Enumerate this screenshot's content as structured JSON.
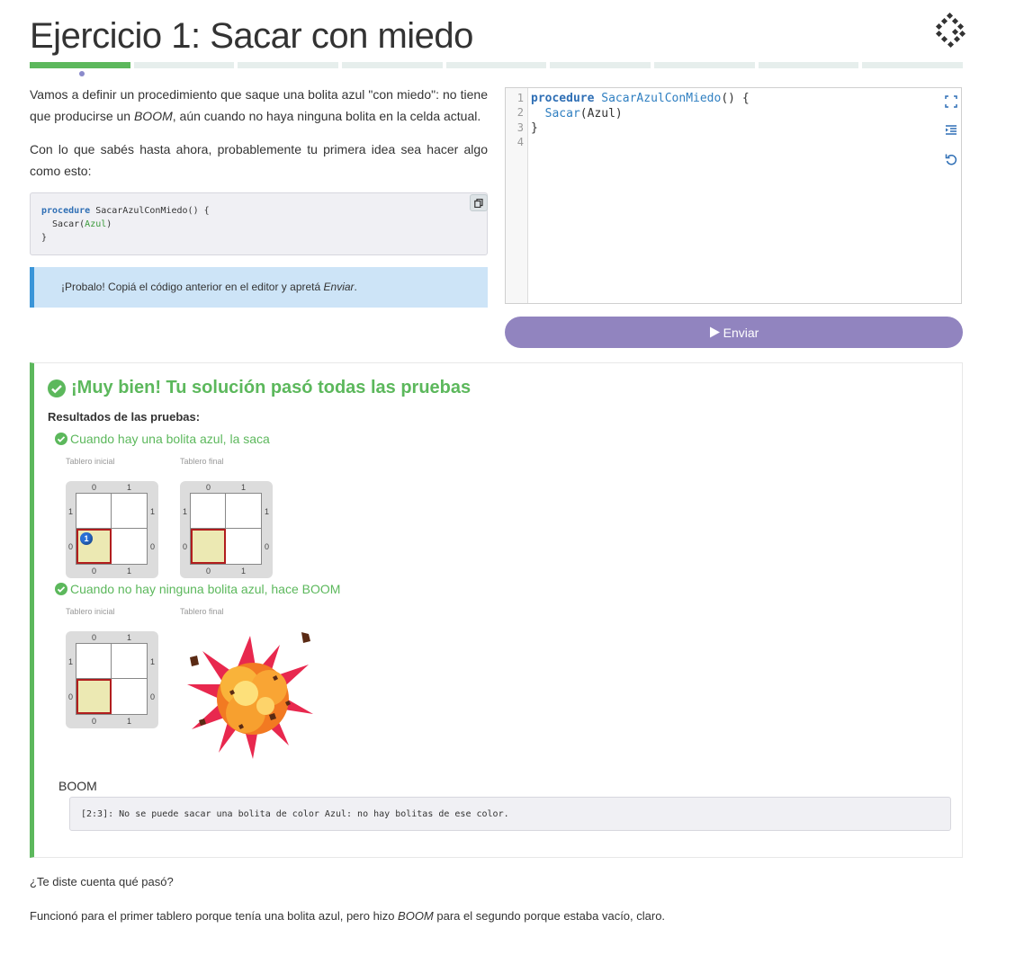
{
  "header": {
    "title": "Ejercicio 1: Sacar con miedo",
    "progress": {
      "segments": 9,
      "completed": 1
    }
  },
  "intro": {
    "p1_a": "Vamos a definir un procedimiento que saque una bolita azul \"con miedo\": no tiene que producirse un ",
    "p1_em": "BOOM",
    "p1_b": ", aún cuando no haya ninguna bolita en la celda actual.",
    "p2": "Con lo que sabés hasta ahora, probablemente tu primera idea sea hacer algo como esto:"
  },
  "snippet": {
    "kw": "procedure",
    "line1_rest": " SacarAzulConMiedo() {",
    "line2_a": "  Sacar(",
    "line2_color": "Azul",
    "line2_b": ")",
    "line3": "}",
    "copy_icon": "copy-icon"
  },
  "tip": {
    "text_a": "¡Probalo! Copiá el código anterior en el editor y apretá ",
    "text_em": "Enviar",
    "text_b": "."
  },
  "editor": {
    "line_numbers": [
      "1",
      "2",
      "3",
      "4"
    ],
    "kw": "procedure",
    "proc_name": "SacarAzulConMiedo",
    "line1_rest": "() {",
    "line2_indent": "  ",
    "line2_fn": "Sacar",
    "line2_rest": "(Azul)",
    "line3": "}",
    "icons": [
      "fullscreen-icon",
      "indent-icon",
      "reset-icon"
    ]
  },
  "submit": {
    "label": "Enviar",
    "icon": "play-icon"
  },
  "results": {
    "title": "¡Muy bien! Tu solución pasó todas las pruebas",
    "subtitle": "Resultados de las pruebas:",
    "tests": [
      {
        "title": "Cuando hay una bolita azul, la saca",
        "initial_label": "Tablero inicial",
        "final_label": "Tablero final",
        "initial_ball_count": "1"
      },
      {
        "title": "Cuando no hay ninguna bolita azul, hace BOOM",
        "initial_label": "Tablero inicial",
        "final_label": "Tablero final"
      }
    ],
    "board_labels": {
      "zero": "0",
      "one": "1"
    },
    "boom_label": "BOOM",
    "boom_message": "[2:3]: No se puede sacar una bolita de color Azul: no hay bolitas de ese color."
  },
  "outro": {
    "q1": "¿Te diste cuenta qué pasó?",
    "q2_a": "Funcionó para el primer tablero porque tenía una bolita azul, pero hizo ",
    "q2_em": "BOOM",
    "q2_b": " para el segundo porque estaba vacío, claro."
  },
  "colors": {
    "success": "#5cb85c",
    "submit_bg": "#9184bf",
    "tip_bg": "#cde4f7",
    "tip_border": "#3a95d8",
    "selected_cell_border": "#b11d1d",
    "selected_cell_bg": "#ece9b3",
    "ball_blue": "#2a70d6"
  }
}
